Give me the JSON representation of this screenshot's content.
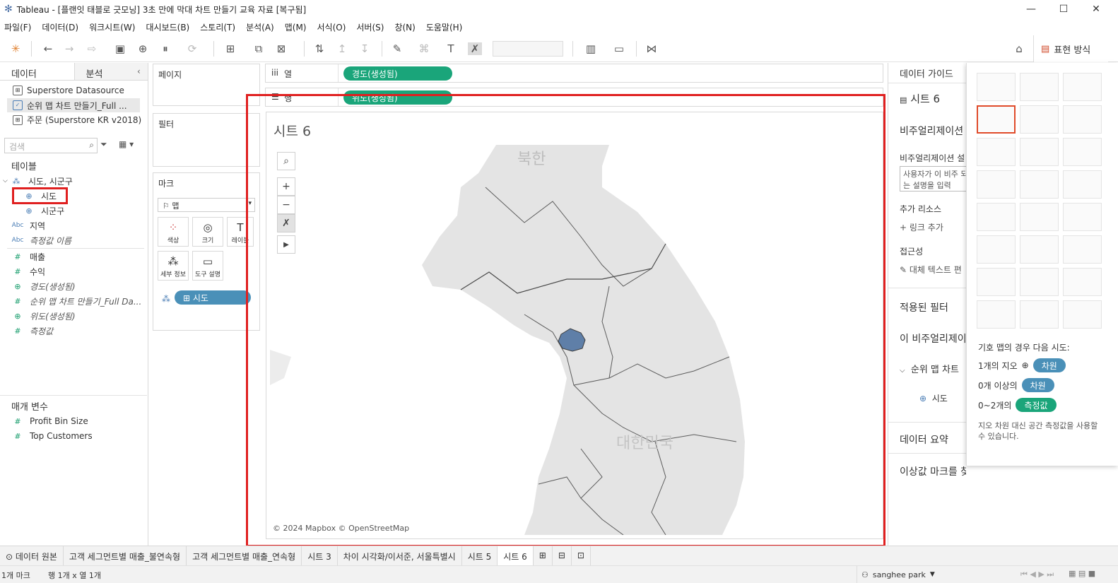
{
  "window": {
    "title": "Tableau - [플랜잇 태블로 긋모닝] 3초 만에 막대 차트 만들기 교육 자료 [복구됨]"
  },
  "menu": [
    "파일(F)",
    "데이터(D)",
    "워크시트(W)",
    "대시보드(B)",
    "스토리(T)",
    "분석(A)",
    "맵(M)",
    "서식(O)",
    "서버(S)",
    "창(N)",
    "도움말(H)"
  ],
  "toolbar": {
    "show_me_label": "표현 방식"
  },
  "data_pane": {
    "tab_data": "데이터",
    "tab_analysis": "분석",
    "datasources": [
      "Superstore Datasource",
      "순위 맵 차트 만들기_Full ...",
      "주문 (Superstore KR v2018)"
    ],
    "search_placeholder": "검색",
    "tables_header": "테이블",
    "hierarchy": "시도, 시군구",
    "fields": [
      {
        "icon": "globe",
        "name": "시도"
      },
      {
        "icon": "globe",
        "name": "시군구"
      },
      {
        "icon": "abc",
        "name": "지역"
      },
      {
        "icon": "abc",
        "name": "측정값 이름"
      },
      {
        "icon": "hash",
        "name": "매출"
      },
      {
        "icon": "hash",
        "name": "수익"
      },
      {
        "icon": "globe",
        "name": "경도(생성됨)"
      },
      {
        "icon": "hash",
        "name": "순위 맵 차트 만들기_Full Da..."
      },
      {
        "icon": "globe",
        "name": "위도(생성됨)"
      },
      {
        "icon": "hash",
        "name": "측정값"
      }
    ],
    "params_header": "매개 변수",
    "params": [
      "Profit Bin Size",
      "Top Customers"
    ]
  },
  "shelves": {
    "pages": "페이지",
    "filters": "필터",
    "marks": "마크",
    "mark_type": "맵",
    "mark_buttons": [
      "색상",
      "크기",
      "레이블",
      "세부 정보",
      "도구 설명"
    ],
    "mark_pill": "시도",
    "columns_label": "열",
    "rows_label": "행",
    "columns_pill": "경도(생성됨)",
    "rows_pill": "위도(생성됨)"
  },
  "view": {
    "sheet_title": "시트 6",
    "label_north": "북한",
    "label_south": "대한민국",
    "attribution": "© 2024 Mapbox © OpenStreetMap"
  },
  "data_guide": {
    "tab": "데이터 가이드",
    "sheet": "시트 6",
    "viz_header": "비주얼리제이션",
    "viz_desc_label": "비주얼리제이션 설",
    "viz_desc_placeholder": "사용자가 이 비주 되는 설명을 입력",
    "resources": "추가 리소스",
    "add_link": "링크 추가",
    "accessibility": "접근성",
    "alt_text": "대체 텍스트 편",
    "applied_filters": "적용된 필터",
    "this_viz": "이 비주얼리제이",
    "tree_item": "순위 맵 차트",
    "tree_field": "시도",
    "data_summary": "데이터 요약",
    "outliers": "이상값 마크를 찾을 수 없음"
  },
  "show_me": {
    "hint": "기호 맵의 경우 다음 시도:",
    "req1_prefix": "1개의 지오",
    "req1_pill": "차원",
    "req2_prefix": "0개 이상의",
    "req2_pill": "차원",
    "req3_prefix": "0~2개의",
    "req3_pill": "측정값",
    "note": "지오 차원 대신 공간 측정값을 사용할 수 있습니다."
  },
  "sheet_tabs": [
    "데이터 원본",
    "고객 세그먼트별 매출_불연속형",
    "고객 세그먼트별 매출_연속형",
    "시트 3",
    "차이 시각화/이서준, 서울특별시",
    "시트 5",
    "시트 6"
  ],
  "status": {
    "marks": "1개 마크",
    "rows_cols": "행 1개 x 열 1개",
    "user": "sanghee park"
  },
  "colors": {
    "highlight": "#e02020",
    "green_pill": "#1aa57a",
    "blue_pill": "#4a90b8",
    "seoul": "#5f7fa8"
  }
}
